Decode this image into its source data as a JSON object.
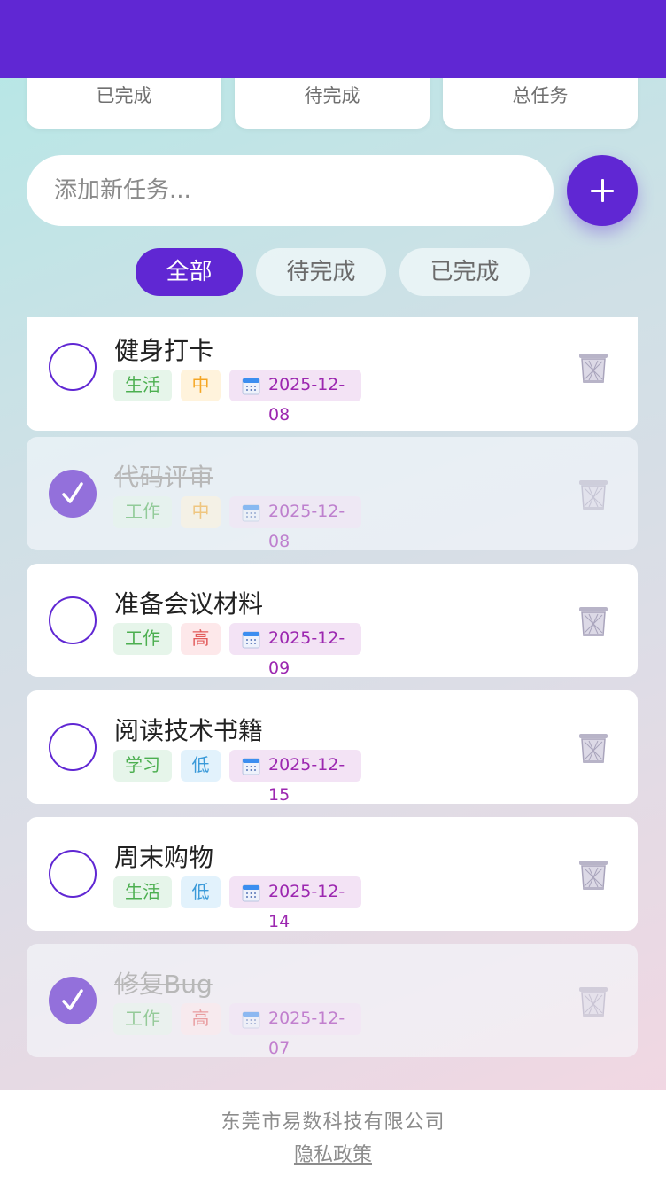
{
  "stats": {
    "completed_label": "已完成",
    "pending_label": "待完成",
    "total_label": "总任务"
  },
  "add_task": {
    "placeholder": "添加新任务...",
    "button_icon": "plus-icon"
  },
  "filters": [
    {
      "label": "全部",
      "active": true
    },
    {
      "label": "待完成",
      "active": false
    },
    {
      "label": "已完成",
      "active": false
    }
  ],
  "tasks": [
    {
      "title": "健身打卡",
      "category": "生活",
      "priority": "中",
      "date": "2025-12-08",
      "done": false
    },
    {
      "title": "代码评审",
      "category": "工作",
      "priority": "中",
      "date": "2025-12-08",
      "done": true
    },
    {
      "title": "准备会议材料",
      "category": "工作",
      "priority": "高",
      "date": "2025-12-09",
      "done": false
    },
    {
      "title": "阅读技术书籍",
      "category": "学习",
      "priority": "低",
      "date": "2025-12-15",
      "done": false
    },
    {
      "title": "周末购物",
      "category": "生活",
      "priority": "低",
      "date": "2025-12-14",
      "done": false
    },
    {
      "title": "修复Bug",
      "category": "工作",
      "priority": "高",
      "date": "2025-12-07",
      "done": true
    }
  ],
  "icons": {
    "date": "calendar-icon",
    "delete": "trash-icon",
    "check": "checkmark-icon"
  },
  "colors": {
    "accent": "#6027d3",
    "done_check": "#9370db"
  },
  "footer": {
    "company": "东莞市易数科技有限公司",
    "privacy_link": "隐私政策"
  }
}
